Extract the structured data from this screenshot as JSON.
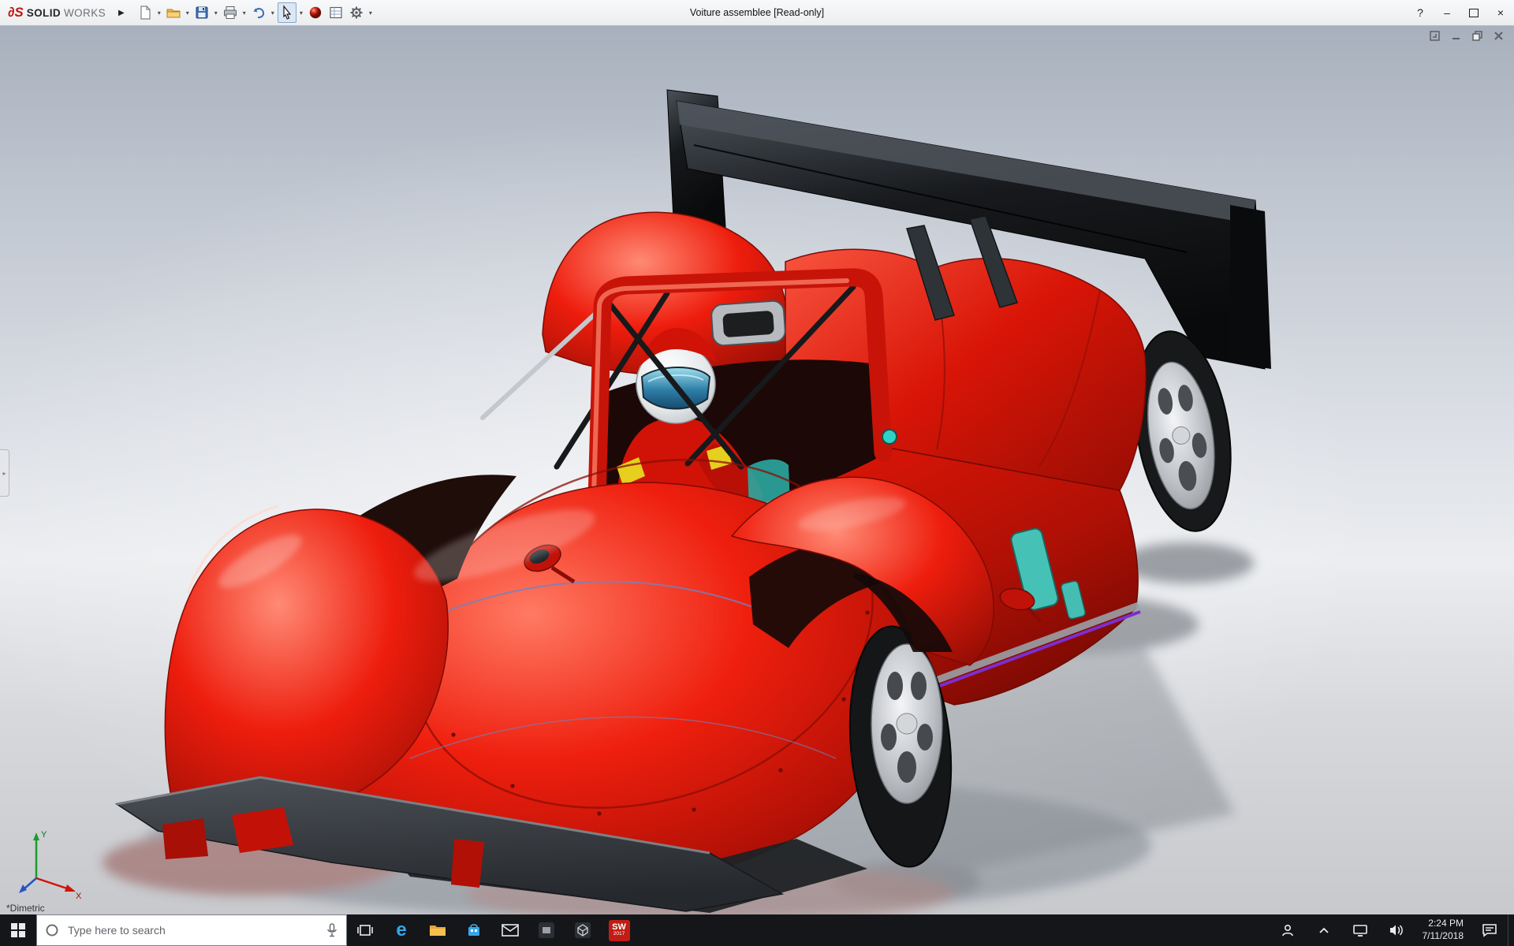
{
  "titlebar": {
    "logo_mark": "∂S",
    "brand_bold": "SOLID",
    "brand_light": "WORKS",
    "title": "Voiture assemblee [Read-only]",
    "controls": {
      "help": "?",
      "minimize": "–",
      "close": "×"
    }
  },
  "glyphs": {
    "caret": "▾",
    "flyout": "▶",
    "left_tab": "▸"
  },
  "toolbar_icons": [
    "new-document",
    "open",
    "save",
    "print",
    "undo",
    "select-arrow",
    "appearance-sphere",
    "drawing-sheet",
    "options-gear"
  ],
  "viewport": {
    "view_label": "*Dimetric",
    "triad": {
      "x_label": "X",
      "y_label": "Y"
    },
    "doc_control_icons": [
      "doc-menu",
      "doc-minimize",
      "doc-restore",
      "doc-close"
    ]
  },
  "taskbar": {
    "search_placeholder": "Type here to search",
    "solidworks_badge": {
      "line1": "SW",
      "line2": "2017"
    },
    "clock": {
      "time": "2:24 PM",
      "date": "7/11/2018"
    },
    "icons": [
      "start",
      "search",
      "microphone",
      "task-view",
      "edge",
      "file-explorer",
      "store",
      "mail",
      "dark-app-1",
      "dark-app-2",
      "solidworks",
      "people",
      "hidden-icons-chevron",
      "network",
      "volume",
      "clock",
      "notifications",
      "show-desktop"
    ]
  },
  "colors": {
    "car_red": "#e8170a",
    "wing_black": "#17191c",
    "visor_teal": "#2d7da6",
    "decal_teal": "#3ed1c6",
    "stripe_purple": "#7a2fd0",
    "taskbar_bg": "#14161a",
    "titlebar_bg": "#f1f2f4"
  }
}
